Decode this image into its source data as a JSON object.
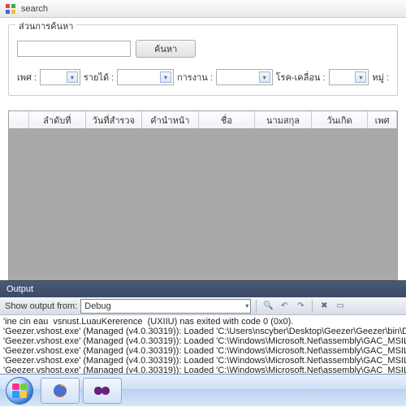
{
  "window": {
    "title": "search"
  },
  "group": {
    "legend": "ส่วนการค้นหา"
  },
  "search": {
    "button": "ค้นหา",
    "value": ""
  },
  "filters": {
    "sex": "เพศ :",
    "income": "รายได้ :",
    "work": "การงาน :",
    "movement": "โรค-เคลื่อน :",
    "moo": "หมู่ :"
  },
  "columns": {
    "c1": "ลำดับที่",
    "c2": "วันที่สำรวจ",
    "c3": "คำนำหน้า",
    "c4": "ชื่อ",
    "c5": "นามสกุล",
    "c6": "วันเกิด",
    "c7": "เพศ"
  },
  "output": {
    "title": "Output",
    "label": "Show output from:",
    "source": "Debug",
    "lines": {
      "l0": "'ine cin eau  vsnust.LuauKererence  (UXIIU) nas exited with code 0 (0x0).",
      "l1": "'Geezer.vshost.exe' (Managed (v4.0.30319)): Loaded 'C:\\Users\\nscyber\\Desktop\\Geezer\\Geezer\\bin\\D",
      "l2": "'Geezer.vshost.exe' (Managed (v4.0.30319)): Loaded 'C:\\Windows\\Microsoft.Net\\assembly\\GAC_MSIL\\S",
      "l3": "'Geezer.vshost.exe' (Managed (v4.0.30319)): Loaded 'C:\\Windows\\Microsoft.Net\\assembly\\GAC_MSIL\\A",
      "l4": "'Geezer.vshost.exe' (Managed (v4.0.30319)): Loaded 'C:\\Windows\\Microsoft.Net\\assembly\\GAC_MSIL\\S",
      "l5": "'Geezer.vshost.exe' (Managed (v4.0.30319)): Loaded 'C:\\Windows\\Microsoft.Net\\assembly\\GAC_MSIL\\S"
    }
  }
}
